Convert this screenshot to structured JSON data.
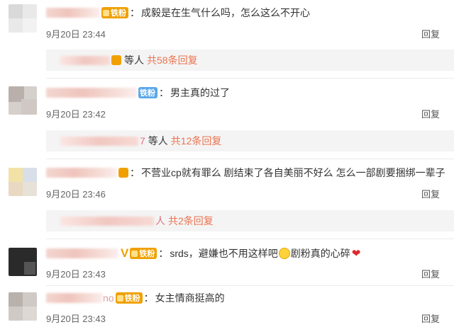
{
  "comments": [
    {
      "badge_label": "铁粉",
      "badge_color": "#f0a000",
      "text": "成毅是在生气什么吗，怎么这么不开心",
      "time": "9月20日 23:44",
      "reply_label": "回复",
      "sub": {
        "etc": "等人",
        "link": "共58条回复"
      }
    },
    {
      "badge_label": "铁粉",
      "badge_color": "#5aa7e8",
      "text": "男主真的过了",
      "time": "9月20日 23:42",
      "reply_label": "回复",
      "sub": {
        "suffix": "7",
        "etc": "等人",
        "link": "共12条回复"
      }
    },
    {
      "badge_label": "",
      "badge_color": "#f0a000",
      "text": "不营业cp就有罪么 剧结束了各自美丽不好么 怎么一部剧要捆绑一辈子",
      "time": "9月20日 23:46",
      "reply_label": "回复",
      "sub": {
        "suffix": "人",
        "link": "共2条回复"
      }
    },
    {
      "badge_label": "铁粉",
      "badge_color": "#f0a000",
      "text_a": "srds，避嫌也不用这样吧",
      "text_b": "剧粉真的心碎",
      "time": "9月20日 23:43",
      "reply_label": "回复",
      "icons": [
        "smile-emoji-icon",
        "broken-heart-icon"
      ]
    },
    {
      "name_tail": "no",
      "badge_label": "铁粉",
      "badge_color": "#f0a000",
      "text": "女主情商挺高的",
      "time": "9月20日 23:43",
      "reply_label": "回复"
    }
  ],
  "colon": "："
}
